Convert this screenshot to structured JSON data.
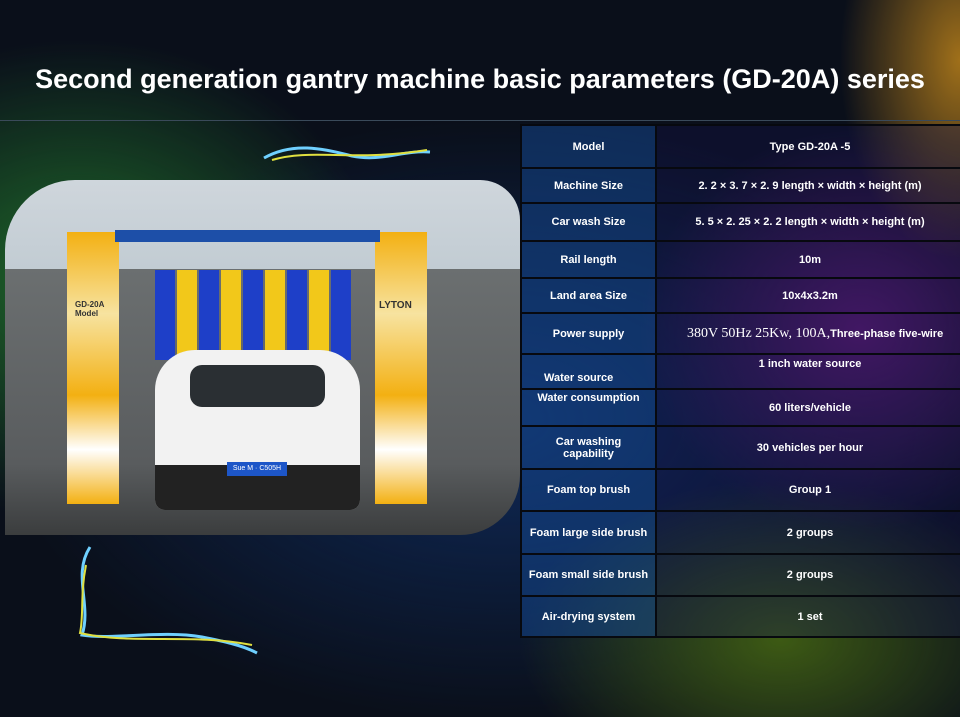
{
  "title": "Second generation gantry machine basic parameters (GD-20A) series",
  "photo": {
    "machine_label": "GD-20A Model",
    "brand": "LYTON",
    "plate": "Sue M · C505H"
  },
  "table": [
    {
      "key": "Model",
      "value": "Type GD-20A -5"
    },
    {
      "key": "Machine Size",
      "value": "2. 2 × 3. 7 × 2. 9 length × width × height (m)"
    },
    {
      "key": "Car wash Size",
      "value": "5. 5 × 2. 25 × 2. 2 length × width × height (m)"
    },
    {
      "key": "Rail length",
      "value": "10m"
    },
    {
      "key": "Land area Size",
      "value": "10x4x3.2m"
    },
    {
      "key": "Power supply",
      "value": "380V 50Hz 25Kw, 100A,",
      "value_suffix": "Three-phase five-wire"
    },
    {
      "key": "Water source",
      "value": "1 inch water source"
    },
    {
      "key": "Water consumption",
      "value": "60 liters/vehicle"
    },
    {
      "key": "Car washing capability",
      "value": "30 vehicles per hour"
    },
    {
      "key": "Foam top brush",
      "value": "Group 1"
    },
    {
      "key": "Foam large side brush",
      "value": "2 groups"
    },
    {
      "key": "Foam small side brush",
      "value": "2 groups"
    },
    {
      "key": "Air-drying system",
      "value": "1 set"
    }
  ]
}
